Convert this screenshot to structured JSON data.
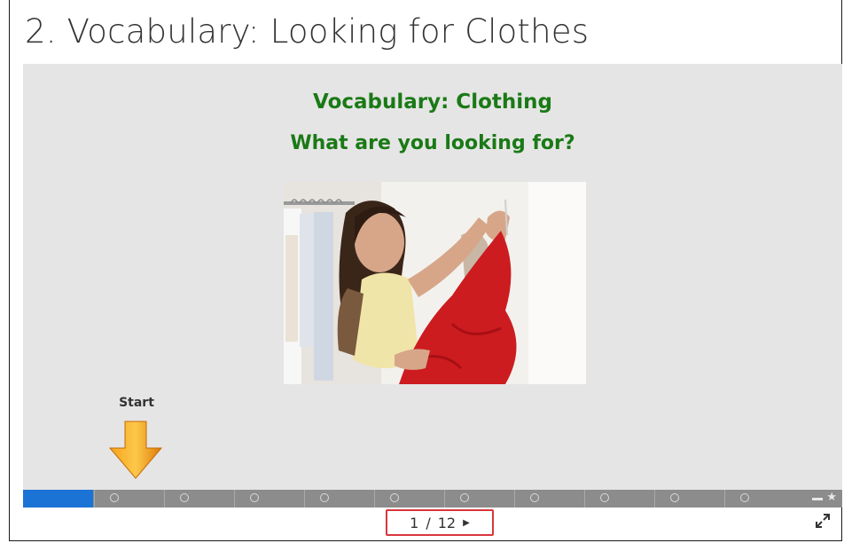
{
  "page": {
    "title": "2. Vocabulary: Looking for Clothes"
  },
  "slide": {
    "heading": "Vocabulary: Clothing",
    "subheading": "What are you looking for?",
    "start_label": "Start",
    "heading_color": "#1a7a16"
  },
  "progress": {
    "fraction_complete": 0.085,
    "slide_markers": 10,
    "fill_color": "#1c73d6",
    "end_icon": "star-icon"
  },
  "pager": {
    "current": "1",
    "separator": "/",
    "total": "12",
    "next_icon": "triangle-right-icon"
  },
  "toolbar": {
    "fullscreen_icon": "expand-icon"
  }
}
